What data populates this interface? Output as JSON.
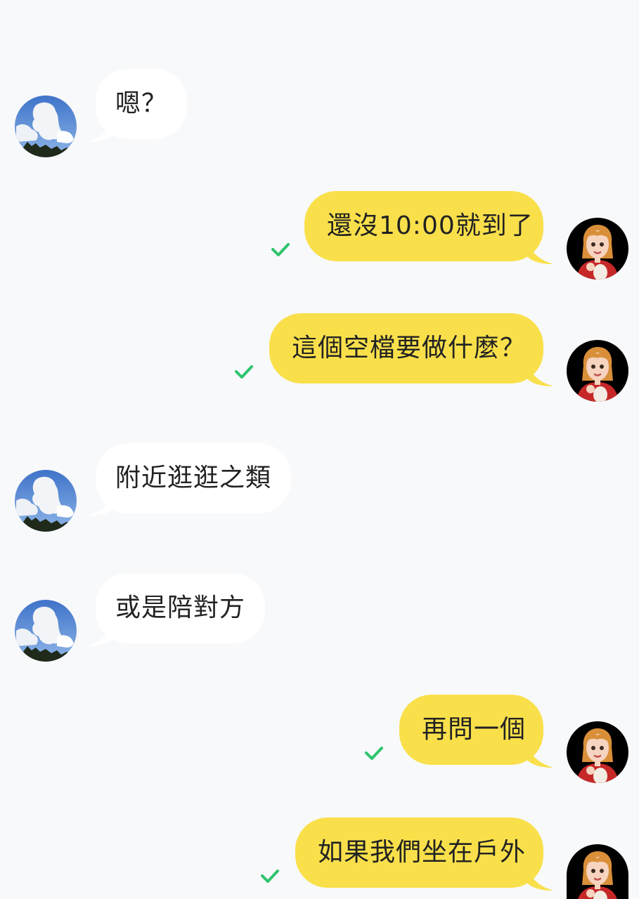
{
  "chat": {
    "messages": [
      {
        "sender": "contact",
        "text": "嗯？"
      },
      {
        "sender": "me",
        "text": "還沒10:00就到了",
        "status": "read"
      },
      {
        "sender": "me",
        "text": "這個空檔要做什麼？",
        "status": "read"
      },
      {
        "sender": "contact",
        "text": "附近逛逛之類"
      },
      {
        "sender": "contact",
        "text": "或是陪對方"
      },
      {
        "sender": "me",
        "text": "再問一個",
        "status": "read"
      },
      {
        "sender": "me",
        "text": "如果我們坐在戶外",
        "status": "read"
      }
    ]
  },
  "colors": {
    "background": "#f8f9fb",
    "incoming_bubble": "#ffffff",
    "outgoing_bubble": "#f9e04b",
    "read_check": "#2ec46d",
    "text": "#222222"
  },
  "icons": {
    "contact_avatar": "sky-cloud-avatar",
    "my_avatar": "cartoon-girl-avatar",
    "read_status": "checkmark-icon"
  }
}
